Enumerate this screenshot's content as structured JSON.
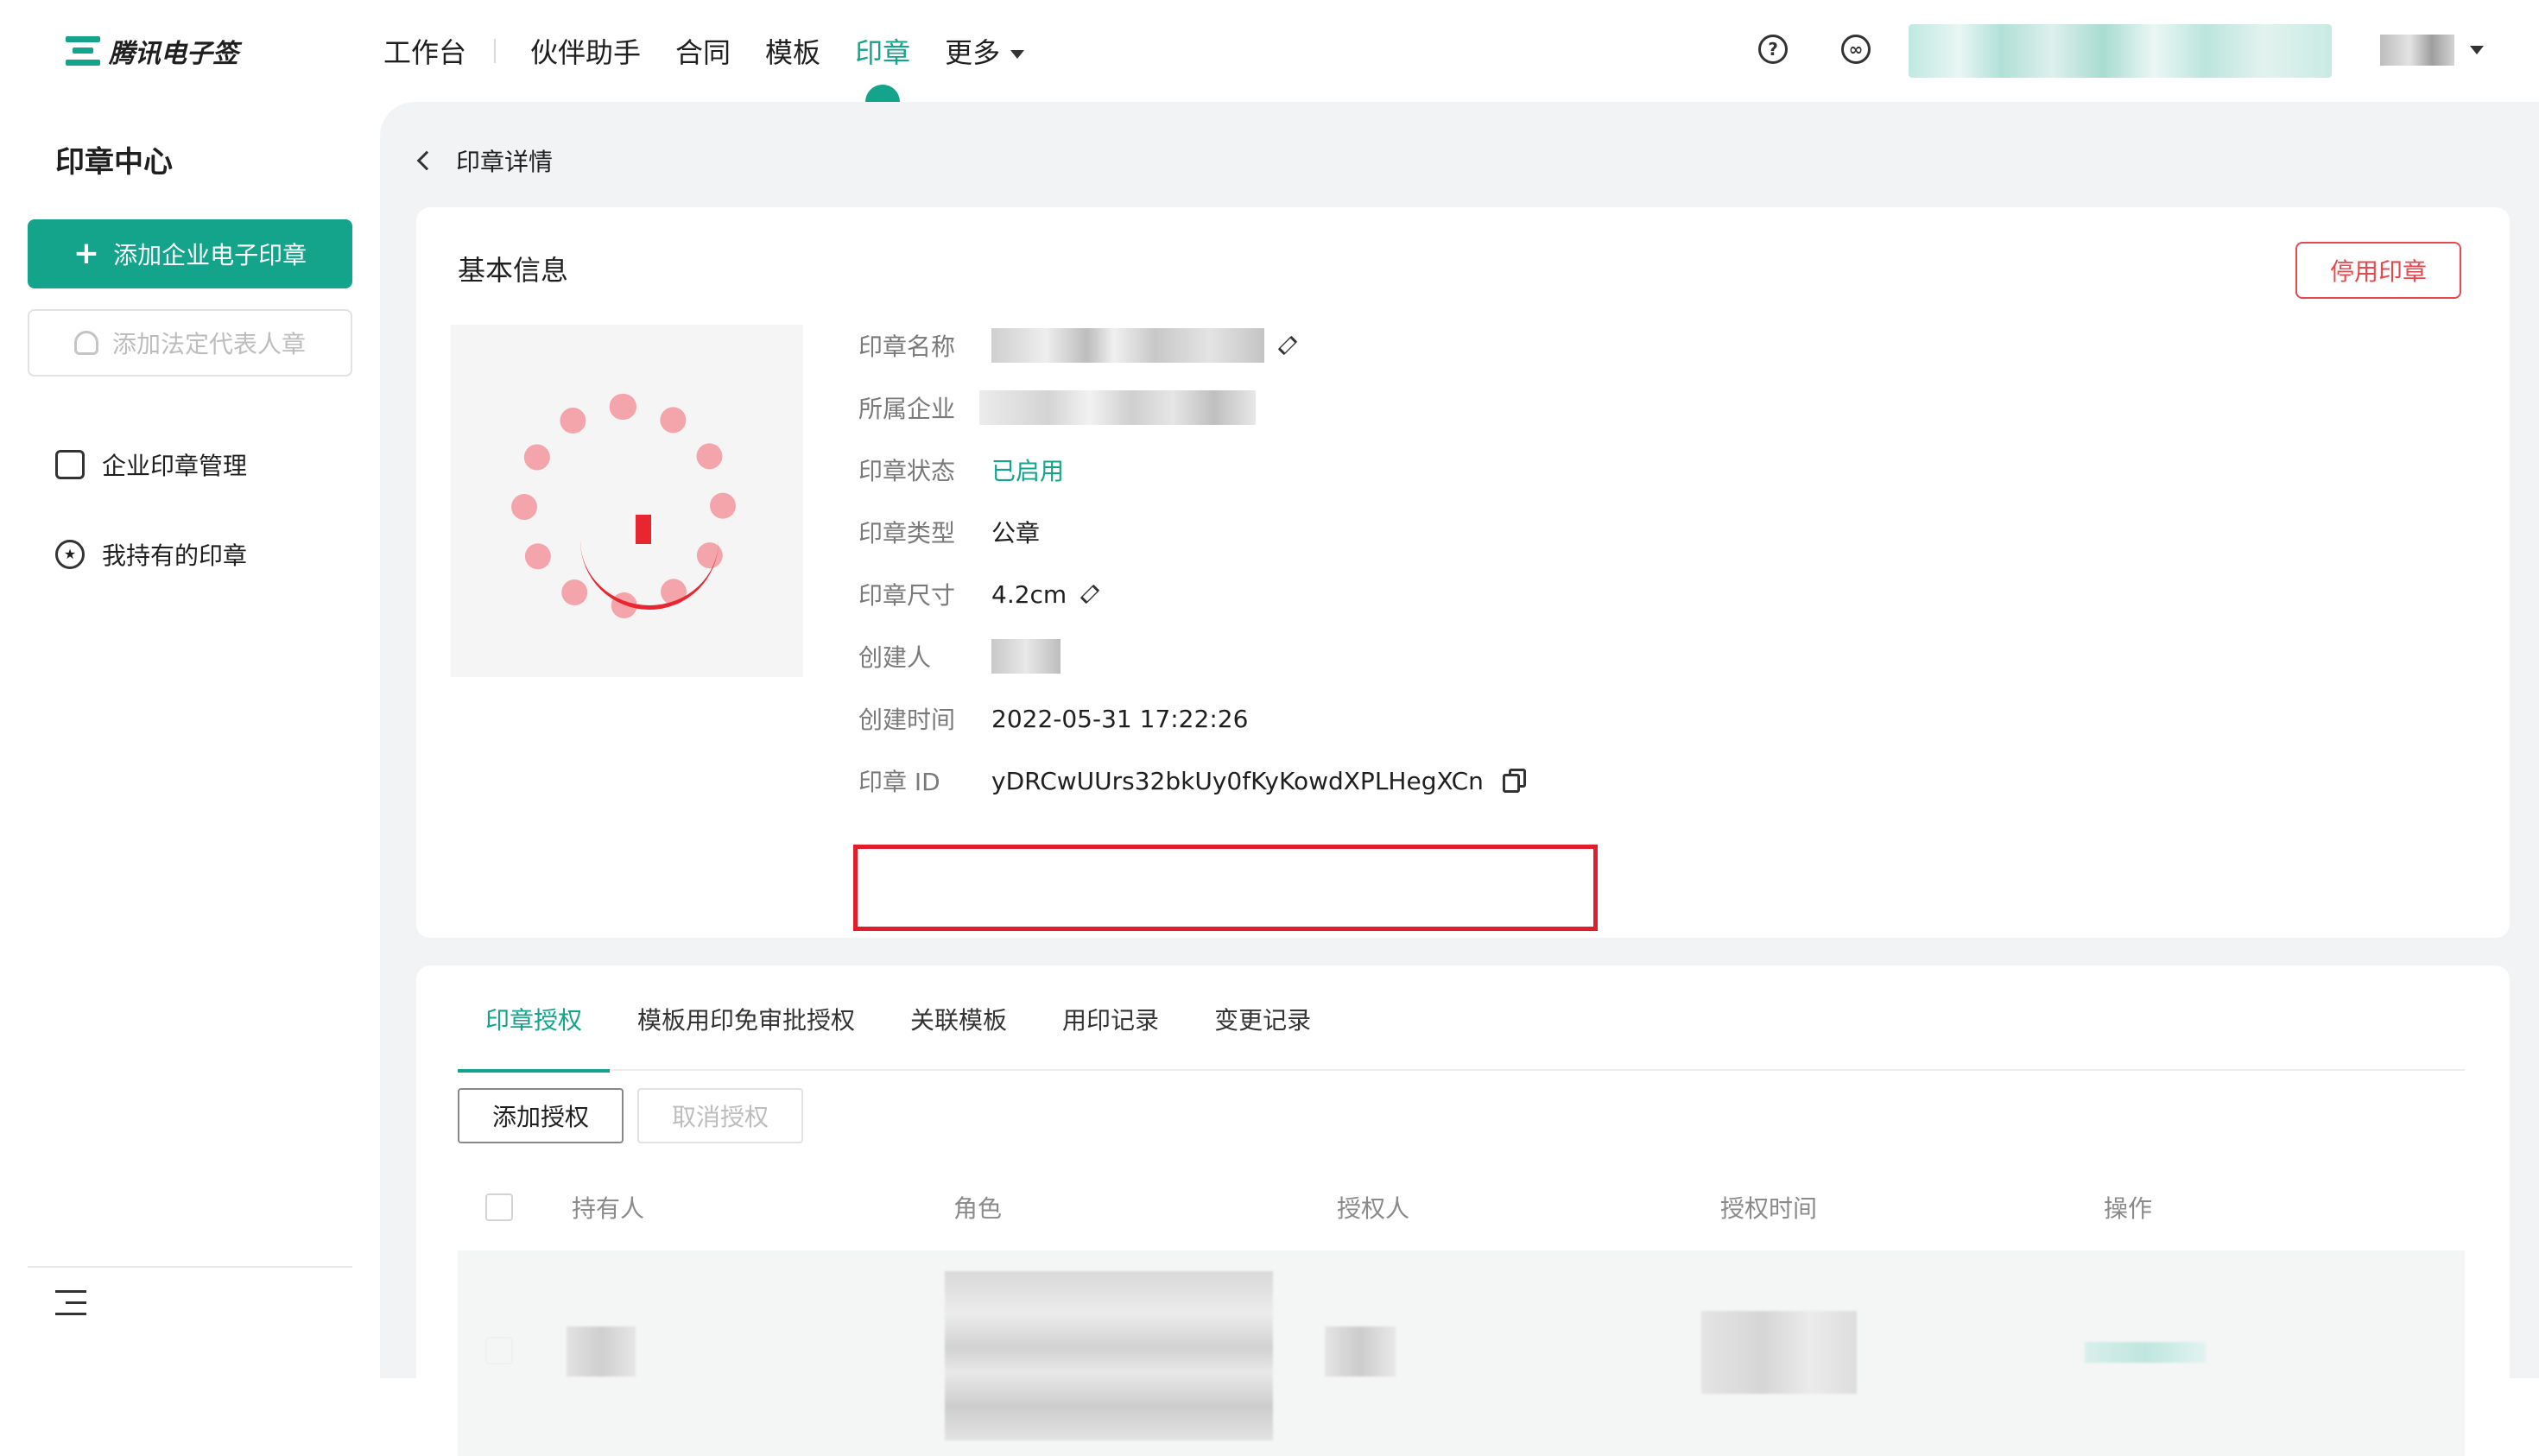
{
  "brand": {
    "name": "腾讯电子签",
    "accent": "#14a38b"
  },
  "nav": {
    "items": [
      "工作台",
      "伙伴助手",
      "合同",
      "模板",
      "印章",
      "更多"
    ],
    "active_index": 4
  },
  "header": {
    "help_icon": "question-circle-icon",
    "link_icon": "link-circle-icon"
  },
  "sidebar": {
    "title": "印章中心",
    "primary_button": "添加企业电子印章",
    "disabled_button": "添加法定代表人章",
    "items": [
      {
        "label": "企业印章管理",
        "icon": "stamp-icon"
      },
      {
        "label": "我持有的印章",
        "icon": "star-circle-icon"
      }
    ]
  },
  "breadcrumb": {
    "label": "印章详情"
  },
  "basic_info": {
    "title": "基本信息",
    "disable_button": "停用印章",
    "fields": {
      "name_label": "印章名称",
      "company_label": "所属企业",
      "status_label": "印章状态",
      "status_value": "已启用",
      "type_label": "印章类型",
      "type_value": "公章",
      "size_label": "印章尺寸",
      "size_value": "4.2cm",
      "creator_label": "创建人",
      "created_time_label": "创建时间",
      "created_time_value": "2022-05-31 17:22:26",
      "id_label": "印章 ID",
      "id_value": "yDRCwUUrs32bkUy0fKyKowdXPLHegXCn"
    },
    "colors": {
      "danger": "#e5484d",
      "highlight": "#e11d2b"
    }
  },
  "auth": {
    "tabs": [
      "印章授权",
      "模板用印免审批授权",
      "关联模板",
      "用印记录",
      "变更记录"
    ],
    "active_tab": 0,
    "add_button": "添加授权",
    "cancel_button": "取消授权",
    "columns": [
      "持有人",
      "角色",
      "授权人",
      "授权时间",
      "操作"
    ]
  }
}
